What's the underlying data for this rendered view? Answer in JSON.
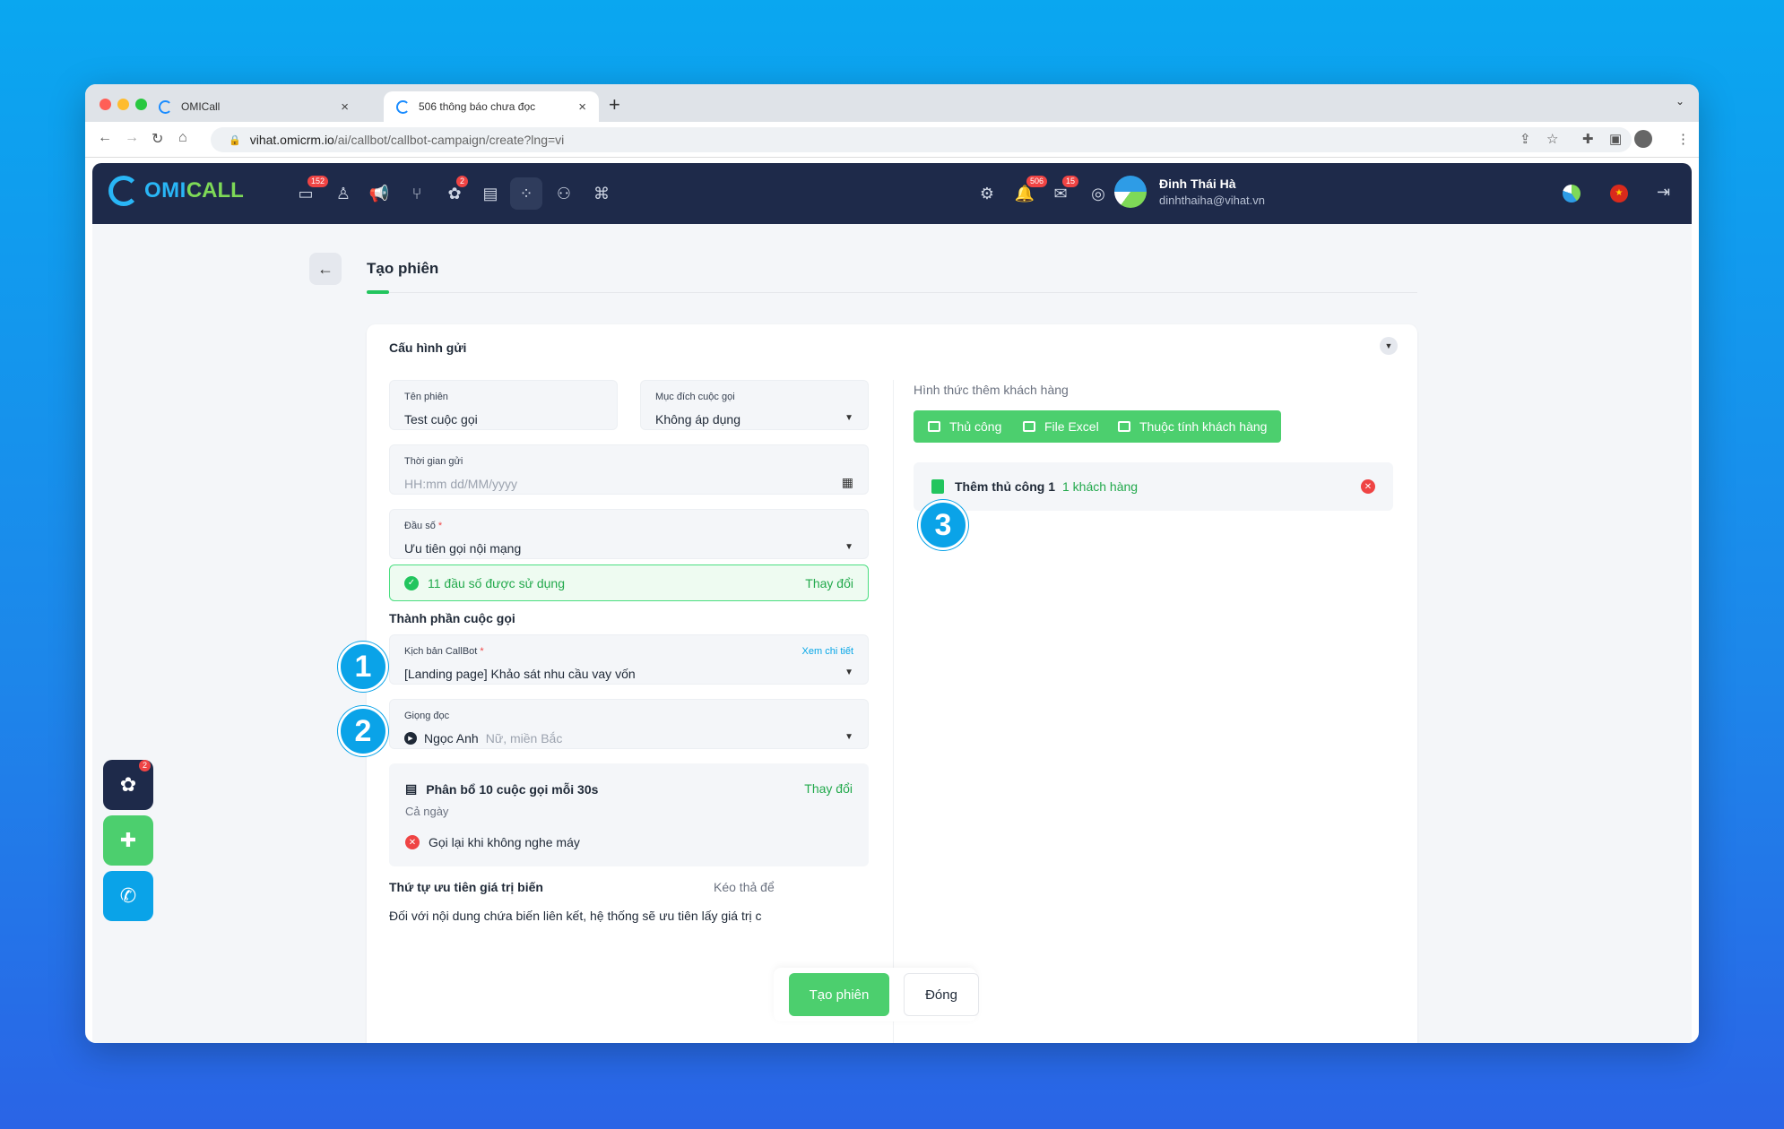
{
  "browser": {
    "tabs": [
      {
        "label": "OMICall"
      },
      {
        "label": "506 thông báo chưa đọc"
      }
    ],
    "url_host": "vihat.omicrm.io",
    "url_path": "/ai/callbot/callbot-campaign/create?lng=vi"
  },
  "topnav": {
    "logo_omi": "OMI",
    "logo_call": "CALL",
    "badges": {
      "tickets": "152",
      "plugins": "2",
      "notifications": "506",
      "mail": "15"
    },
    "user_name": "Đinh Thái Hà",
    "user_email": "dinhthaiha@vihat.vn"
  },
  "page": {
    "title": "Tạo phiên",
    "card_title": "Cấu hình gửi"
  },
  "form": {
    "session_name_label": "Tên phiên",
    "session_name_value": "Test cuộc gọi",
    "purpose_label": "Mục đích cuộc gọi",
    "purpose_value": "Không áp dụng",
    "send_time_label": "Thời gian gửi",
    "send_time_placeholder": "HH:mm dd/MM/yyyy",
    "number_label": "Đầu số",
    "number_value": "Ưu tiên gọi nội mạng",
    "numbers_used": "11 đầu số được sử dụng",
    "change": "Thay đổi",
    "components_title": "Thành phần cuộc gọi",
    "script_label": "Kịch bản CallBot",
    "script_link": "Xem chi tiết",
    "script_value": "[Landing page] Khảo sát nhu cầu vay vốn",
    "voice_label": "Giọng đọc",
    "voice_name": "Ngọc Anh",
    "voice_desc": "Nữ, miền Bắc",
    "allocation": "Phân bổ 10 cuộc gọi mỗi 30s",
    "allocation_time": "Cả ngày",
    "recall": "Gọi lại khi không nghe máy",
    "priority_title": "Thứ tự ưu tiên giá trị biến",
    "priority_drag": "Kéo thả để",
    "priority_desc": "Đối với nội dung chứa biến liên kết, hệ thống sẽ ưu tiên lấy giá trị c"
  },
  "customers": {
    "title": "Hình thức thêm khách hàng",
    "btn_manual": "Thủ công",
    "btn_excel": "File Excel",
    "btn_attr": "Thuộc tính khách hàng",
    "added_name": "Thêm thủ công 1",
    "added_count": "1 khách hàng"
  },
  "markers": {
    "m1": "1",
    "m2": "2",
    "m3": "3"
  },
  "actions": {
    "create": "Tạo phiên",
    "close": "Đóng"
  },
  "fab": {
    "badge": "2"
  },
  "colors": {
    "accent_green": "#4ccf6e",
    "nav_bg": "#1e2a4a",
    "marker_blue": "#0aa3e8"
  }
}
